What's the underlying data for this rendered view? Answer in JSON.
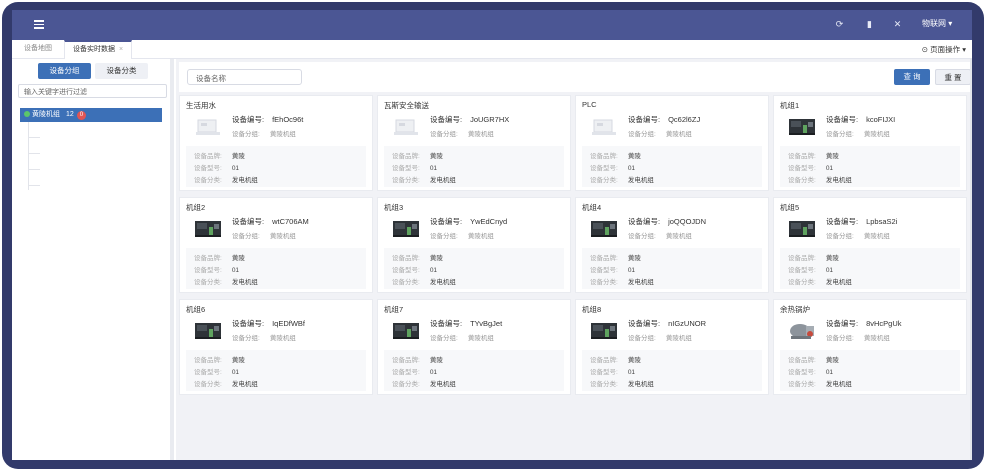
{
  "topbar": {
    "user_label": "物联网 ▾",
    "icons": [
      "refresh-icon",
      "delete-icon",
      "fullscreen-icon"
    ]
  },
  "tabs": [
    {
      "label": "设备地图",
      "active": false
    },
    {
      "label": "设备实时数据",
      "active": true,
      "close": "×"
    }
  ],
  "page_ops": {
    "label": "⊙ 页面操作 ▾"
  },
  "left": {
    "tab_group": "设备分组",
    "tab_category": "设备分类",
    "filter_placeholder": "输入关键字进行过滤",
    "tree_node": {
      "label": "黄陵机组",
      "count": "12",
      "badge": "0"
    }
  },
  "main": {
    "search_placeholder": "设备名称",
    "query_label": "查 询",
    "reset_label": "重 置"
  },
  "labels": {
    "code": "设备编号:",
    "group": "设备分组:",
    "brand": "设备品牌:",
    "model": "设备型号:",
    "category": "设备分类:"
  },
  "cards": [
    {
      "title": "生活用水",
      "code": "fEhOc96t",
      "group": "黄陵机组",
      "brand": "黄陵",
      "model": "01",
      "category": "发电机组",
      "img": "placeholder"
    },
    {
      "title": "瓦斯安全输送",
      "code": "JoUGR7HX",
      "group": "黄陵机组",
      "brand": "黄陵",
      "model": "01",
      "category": "发电机组",
      "img": "placeholder"
    },
    {
      "title": "PLC",
      "code": "Qc62l6ZJ",
      "group": "黄陵机组",
      "brand": "黄陵",
      "model": "01",
      "category": "发电机组",
      "img": "placeholder"
    },
    {
      "title": "机组1",
      "code": "kcoFIJXI",
      "group": "黄陵机组",
      "brand": "黄陵",
      "model": "01",
      "category": "发电机组",
      "img": "engine"
    },
    {
      "title": "机组2",
      "code": "wtC706AM",
      "group": "黄陵机组",
      "brand": "黄陵",
      "model": "01",
      "category": "发电机组",
      "img": "engine"
    },
    {
      "title": "机组3",
      "code": "YwEdCnyd",
      "group": "黄陵机组",
      "brand": "黄陵",
      "model": "01",
      "category": "发电机组",
      "img": "engine"
    },
    {
      "title": "机组4",
      "code": "joQQOJDN",
      "group": "黄陵机组",
      "brand": "黄陵",
      "model": "01",
      "category": "发电机组",
      "img": "engine"
    },
    {
      "title": "机组5",
      "code": "LpbsaS2i",
      "group": "黄陵机组",
      "brand": "黄陵",
      "model": "01",
      "category": "发电机组",
      "img": "engine"
    },
    {
      "title": "机组6",
      "code": "IqEDfWBf",
      "group": "黄陵机组",
      "brand": "黄陵",
      "model": "01",
      "category": "发电机组",
      "img": "engine"
    },
    {
      "title": "机组7",
      "code": "TYvBgJet",
      "group": "黄陵机组",
      "brand": "黄陵",
      "model": "01",
      "category": "发电机组",
      "img": "engine"
    },
    {
      "title": "机组8",
      "code": "nIGzUNOR",
      "group": "黄陵机组",
      "brand": "黄陵",
      "model": "01",
      "category": "发电机组",
      "img": "engine"
    },
    {
      "title": "余热锅炉",
      "code": "8vHcPgUk",
      "group": "黄陵机组",
      "brand": "黄陵",
      "model": "01",
      "category": "发电机组",
      "img": "boiler"
    }
  ]
}
